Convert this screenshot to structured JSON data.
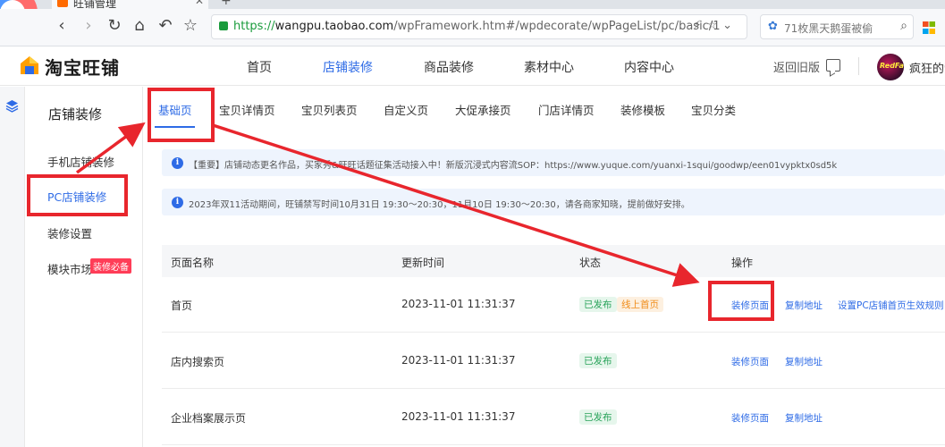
{
  "browser": {
    "tab_title": "旺铺管理",
    "tab_close": "✕",
    "new_tab": "+",
    "url_scheme": "https://",
    "url_host": "wangpu.taobao.com",
    "url_path": "/wpFramework.htm#/wpdecorate/wpPageList/pc/basic/1",
    "search_text": "71枚黑天鹅蛋被偷",
    "nav_back": "‹",
    "nav_forward": "›",
    "nav_reload": "↻",
    "nav_home": "⌂",
    "nav_undo": "↶",
    "nav_star": "☆",
    "url_icons": "⚡☆⌄",
    "search_go": "⌕"
  },
  "header": {
    "logo_text": "淘宝旺铺",
    "nav": [
      "首页",
      "店铺装修",
      "商品装修",
      "素材中心",
      "内容中心"
    ],
    "active_nav": 1,
    "old_version": "返回旧版",
    "avatar_text": "RedFace",
    "username": "疯狂的索"
  },
  "sidebar": {
    "title": "店铺装修",
    "items": [
      {
        "label": "手机店铺装修"
      },
      {
        "label": "PC店铺装修"
      },
      {
        "label": "装修设置"
      },
      {
        "label": "模块市场"
      }
    ],
    "active_index": 1,
    "badge": "装修必备"
  },
  "tabs": [
    "基础页",
    "宝贝详情页",
    "宝贝列表页",
    "自定义页",
    "大促承接页",
    "门店详情页",
    "装修模板",
    "宝贝分类"
  ],
  "notices": [
    "【重要】店铺动态更名作品，买家秀&旺旺话题征集活动接入中！新版沉浸式内容流SOP：https://www.yuque.com/yuanxi-1squi/goodwp/een01vypktx0sd5k",
    "2023年双11活动期间，旺铺禁写时间10月31日 19:30～20:30，11月10日 19:30～20:30，请各商家知晓，提前做好安排。"
  ],
  "table": {
    "headers": [
      "页面名称",
      "更新时间",
      "状态",
      "操作"
    ],
    "rows": [
      {
        "name": "首页",
        "time": "2023-11-01 11:31:37",
        "status": "已发布",
        "extra_tag": "线上首页",
        "ops": [
          "装修页面",
          "复制地址",
          "设置PC店铺首页生效规则"
        ]
      },
      {
        "name": "店内搜索页",
        "time": "2023-11-01 11:31:37",
        "status": "已发布",
        "ops": [
          "装修页面",
          "复制地址"
        ]
      },
      {
        "name": "企业档案展示页",
        "time": "2023-11-01 11:31:37",
        "status": "已发布",
        "ops": [
          "装修页面",
          "复制地址"
        ]
      }
    ]
  },
  "colors": {
    "accent": "#2e6be6",
    "annotation": "#e8262d",
    "published": "#29a35a",
    "online_home": "#f08c1a"
  }
}
